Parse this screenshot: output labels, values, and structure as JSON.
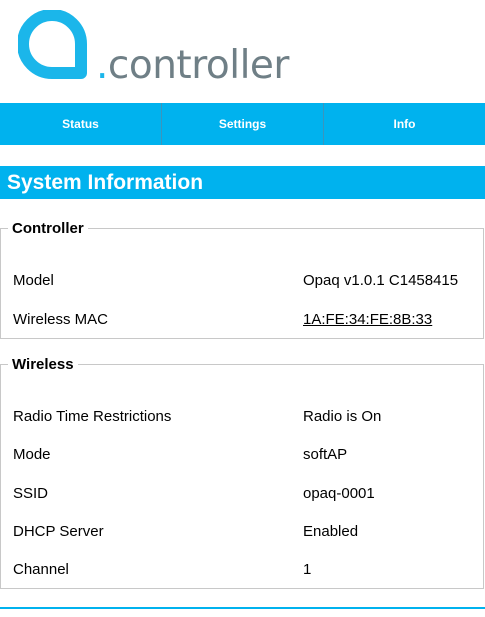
{
  "brand": {
    "logo_dot": ".",
    "logo_text": "controller",
    "accent_color": "#00b2ee",
    "logo_gray": "#6f7f86"
  },
  "nav": {
    "items": [
      {
        "label": "Status"
      },
      {
        "label": "Settings"
      },
      {
        "label": "Info"
      }
    ]
  },
  "page": {
    "title": "System Information"
  },
  "controller": {
    "legend": "Controller",
    "rows": [
      {
        "label": "Model",
        "value": "Opaq v1.0.1 C1458415"
      },
      {
        "label": "Wireless MAC",
        "value": "1A:FE:34:FE:8B:33"
      }
    ]
  },
  "wireless": {
    "legend": "Wireless",
    "rows": [
      {
        "label": "Radio Time Restrictions",
        "value": "Radio is On"
      },
      {
        "label": "Mode",
        "value": "softAP"
      },
      {
        "label": "SSID",
        "value": "opaq-0001"
      },
      {
        "label": "DHCP Server",
        "value": "Enabled"
      },
      {
        "label": "Channel",
        "value": "1"
      }
    ]
  }
}
